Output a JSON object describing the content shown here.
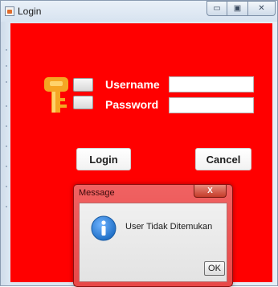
{
  "window": {
    "title": "Login",
    "controls": {
      "minimize_glyph": "▭",
      "maximize_glyph": "▣",
      "close_glyph": "✕"
    }
  },
  "form": {
    "username_label": "Username",
    "password_label": "Password",
    "username_value": "",
    "password_value": "",
    "login_label": "Login",
    "cancel_label": "Cancel"
  },
  "dialog": {
    "title": "Message",
    "close_glyph": "X",
    "message": "User Tidak Ditemukan",
    "ok_label": "OK"
  },
  "colors": {
    "panel_bg": "#ff0000",
    "key_icon": "#f5a623",
    "info_icon": "#1f6fc6"
  },
  "icons": [
    "app-icon",
    "key-icon",
    "info-icon"
  ]
}
